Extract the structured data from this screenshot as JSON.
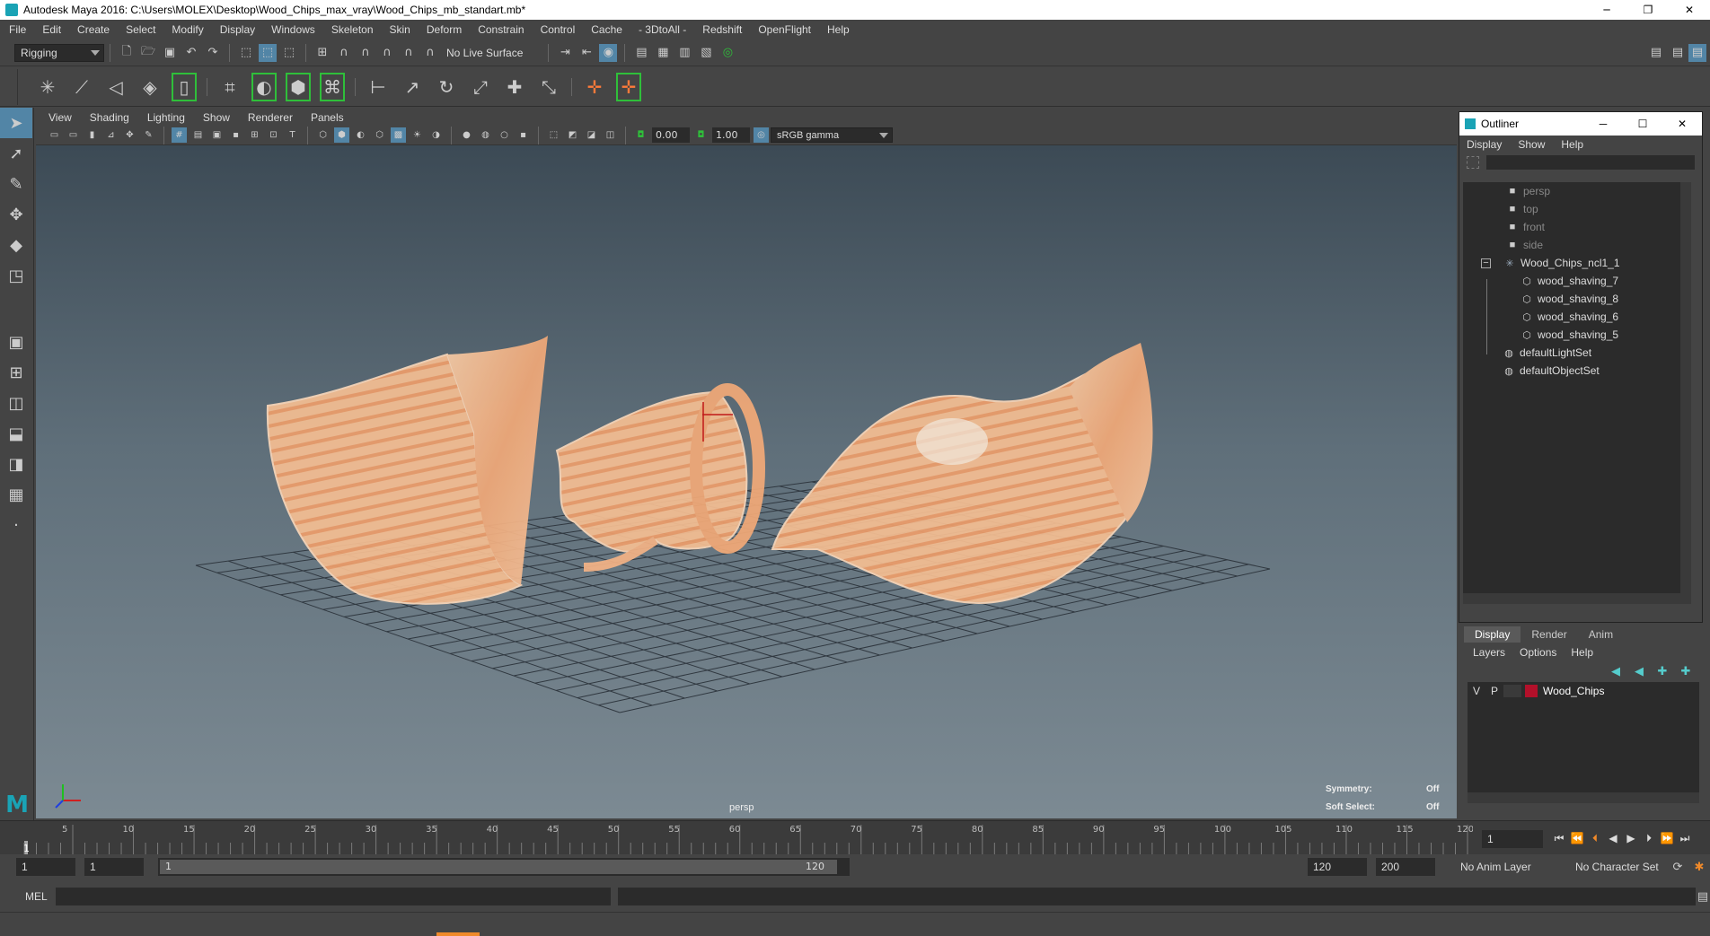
{
  "window": {
    "title": "Autodesk Maya 2016: C:\\Users\\MOLEX\\Desktop\\Wood_Chips_max_vray\\Wood_Chips_mb_standart.mb*",
    "controls": [
      "─",
      "❐",
      "✕"
    ]
  },
  "menubar": [
    "File",
    "Edit",
    "Create",
    "Select",
    "Modify",
    "Display",
    "Windows",
    "Skeleton",
    "Skin",
    "Deform",
    "Constrain",
    "Control",
    "Cache",
    "- 3DtoAll -",
    "Redshift",
    "OpenFlight",
    "Help"
  ],
  "statusline": {
    "menuset": "Rigging",
    "live_surface": "No Live Surface"
  },
  "panel": {
    "menu": [
      "View",
      "Shading",
      "Lighting",
      "Show",
      "Renderer",
      "Panels"
    ],
    "exposure": "0.00",
    "gamma": "1.00",
    "colorspace": "sRGB gamma"
  },
  "viewport": {
    "camera_label": "persp",
    "symmetry_label": "Symmetry:",
    "symmetry_value": "Off",
    "soft_select_label": "Soft Select:",
    "soft_select_value": "Off",
    "wood_color": "#f4b98c"
  },
  "outliner": {
    "title": "Outliner",
    "menu": [
      "Display",
      "Show",
      "Help"
    ],
    "items": [
      {
        "label": "persp",
        "icon": "camera-icon",
        "dim": true
      },
      {
        "label": "top",
        "icon": "camera-icon",
        "dim": true
      },
      {
        "label": "front",
        "icon": "camera-icon",
        "dim": true
      },
      {
        "label": "side",
        "icon": "camera-icon",
        "dim": true
      },
      {
        "label": "Wood_Chips_ncl1_1",
        "icon": "group-icon",
        "dim": false
      },
      {
        "label": "wood_shaving_7",
        "icon": "mesh-icon",
        "dim": false
      },
      {
        "label": "wood_shaving_8",
        "icon": "mesh-icon",
        "dim": false
      },
      {
        "label": "wood_shaving_6",
        "icon": "mesh-icon",
        "dim": false
      },
      {
        "label": "wood_shaving_5",
        "icon": "mesh-icon",
        "dim": false
      },
      {
        "label": "defaultLightSet",
        "icon": "set-icon",
        "dim": false
      },
      {
        "label": "defaultObjectSet",
        "icon": "set-icon",
        "dim": false
      }
    ]
  },
  "layers": {
    "tabs": [
      "Display",
      "Render",
      "Anim"
    ],
    "menu": [
      "Layers",
      "Options",
      "Help"
    ],
    "row": {
      "v": "V",
      "p": "P",
      "name": "Wood_Chips",
      "color": "#b3102a"
    }
  },
  "timeline": {
    "ticks": [
      "5",
      "10",
      "15",
      "20",
      "25",
      "30",
      "35",
      "40",
      "45",
      "50",
      "55",
      "60",
      "65",
      "70",
      "75",
      "80",
      "85",
      "90",
      "95",
      "100",
      "105",
      "110",
      "115",
      "120"
    ],
    "first_tick": "1",
    "current_frame": "1"
  },
  "range": {
    "start": "1",
    "playback_start": "1",
    "slider_start": "1",
    "slider_end": "120",
    "playback_end": "120",
    "end": "200",
    "anim_layer": "No Anim Layer",
    "char_set": "No Character Set"
  },
  "cmdline": {
    "label": "MEL"
  }
}
